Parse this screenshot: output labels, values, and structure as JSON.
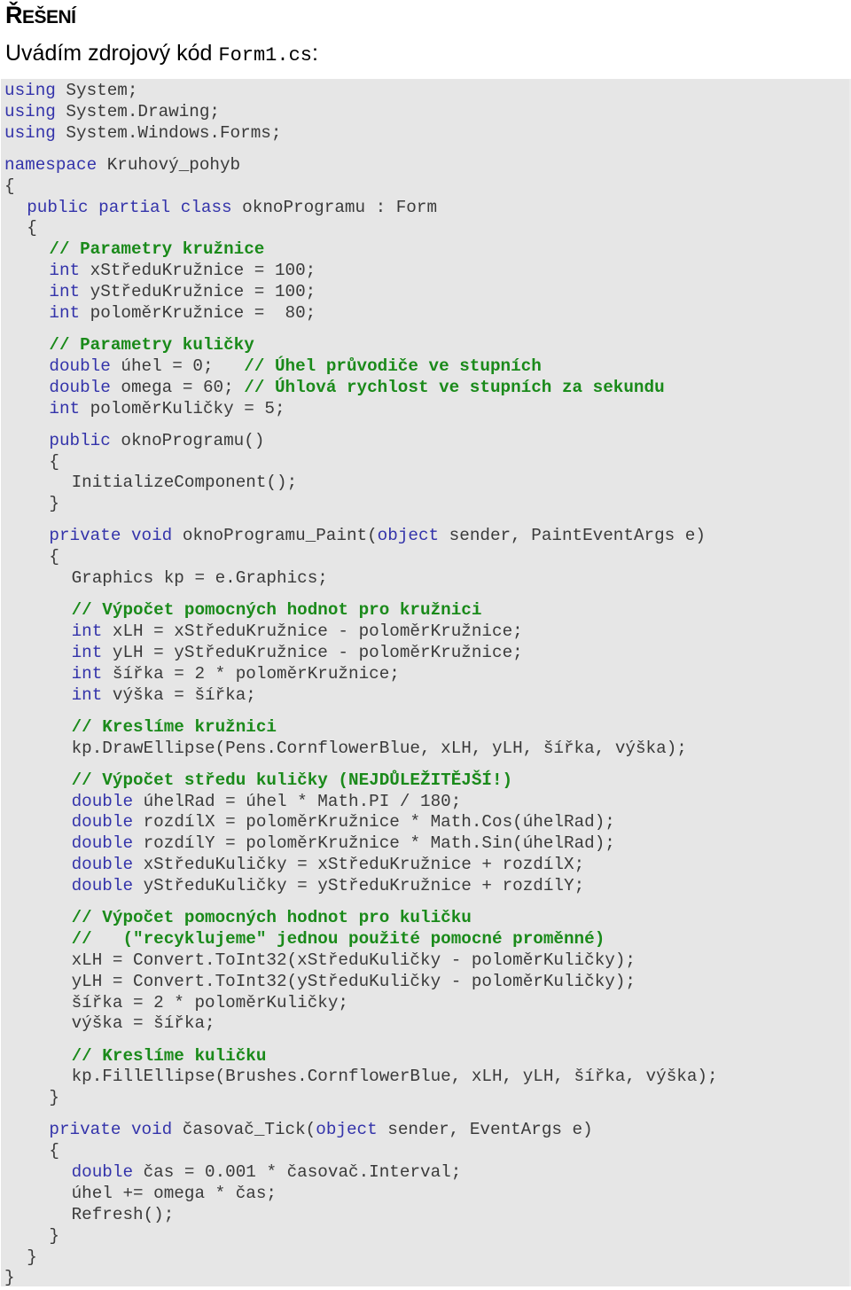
{
  "heading": {
    "first_letter": "Ř",
    "rest": "EŠENÍ"
  },
  "intro": {
    "text": "Uvádím zdrojový kód ",
    "filename": "Form1.cs",
    "suffix": ":"
  },
  "colors": {
    "keyword": "#3333aa",
    "comment": "#1a8a1a",
    "text": "#3a3a3a",
    "code_background": "#e6e6e6"
  },
  "code": {
    "language": "C#",
    "lines": [
      {
        "indent": 0,
        "parts": [
          {
            "t": "kw",
            "s": "using"
          },
          {
            "t": "tx",
            "s": " System;"
          }
        ]
      },
      {
        "indent": 0,
        "parts": [
          {
            "t": "kw",
            "s": "using"
          },
          {
            "t": "tx",
            "s": " System.Drawing;"
          }
        ]
      },
      {
        "indent": 0,
        "parts": [
          {
            "t": "kw",
            "s": "using"
          },
          {
            "t": "tx",
            "s": " System.Windows.Forms;"
          }
        ]
      },
      {
        "indent": 0,
        "gap": true,
        "parts": [
          {
            "t": "kw",
            "s": "namespace"
          },
          {
            "t": "tx",
            "s": " Kruhový_pohyb"
          }
        ]
      },
      {
        "indent": 0,
        "parts": [
          {
            "t": "tx",
            "s": "{"
          }
        ]
      },
      {
        "indent": 1,
        "parts": [
          {
            "t": "kw",
            "s": "public partial class"
          },
          {
            "t": "tx",
            "s": " oknoProgramu : Form"
          }
        ]
      },
      {
        "indent": 1,
        "parts": [
          {
            "t": "tx",
            "s": "{"
          }
        ]
      },
      {
        "indent": 2,
        "parts": [
          {
            "t": "cm",
            "s": "// Parametry kružnice"
          }
        ]
      },
      {
        "indent": 2,
        "parts": [
          {
            "t": "kw",
            "s": "int"
          },
          {
            "t": "tx",
            "s": " xStředuKružnice = 100;"
          }
        ]
      },
      {
        "indent": 2,
        "parts": [
          {
            "t": "kw",
            "s": "int"
          },
          {
            "t": "tx",
            "s": " yStředuKružnice = 100;"
          }
        ]
      },
      {
        "indent": 2,
        "parts": [
          {
            "t": "kw",
            "s": "int"
          },
          {
            "t": "tx",
            "s": " poloměrKružnice =  80;"
          }
        ]
      },
      {
        "indent": 2,
        "gap": true,
        "parts": [
          {
            "t": "cm",
            "s": "// Parametry kuličky"
          }
        ]
      },
      {
        "indent": 2,
        "parts": [
          {
            "t": "kw",
            "s": "double"
          },
          {
            "t": "tx",
            "s": " úhel = 0;   "
          },
          {
            "t": "cm",
            "s": "// Úhel průvodiče ve stupních"
          }
        ]
      },
      {
        "indent": 2,
        "parts": [
          {
            "t": "kw",
            "s": "double"
          },
          {
            "t": "tx",
            "s": " omega = 60; "
          },
          {
            "t": "cm",
            "s": "// Úhlová rychlost ve stupních za sekundu"
          }
        ]
      },
      {
        "indent": 2,
        "parts": [
          {
            "t": "kw",
            "s": "int"
          },
          {
            "t": "tx",
            "s": " poloměrKuličky = 5;"
          }
        ]
      },
      {
        "indent": 2,
        "gap": true,
        "parts": [
          {
            "t": "kw",
            "s": "public"
          },
          {
            "t": "tx",
            "s": " oknoProgramu()"
          }
        ]
      },
      {
        "indent": 2,
        "parts": [
          {
            "t": "tx",
            "s": "{"
          }
        ]
      },
      {
        "indent": 3,
        "parts": [
          {
            "t": "tx",
            "s": "InitializeComponent();"
          }
        ]
      },
      {
        "indent": 2,
        "parts": [
          {
            "t": "tx",
            "s": "}"
          }
        ]
      },
      {
        "indent": 2,
        "gap": true,
        "parts": [
          {
            "t": "kw",
            "s": "private void"
          },
          {
            "t": "tx",
            "s": " oknoProgramu_Paint("
          },
          {
            "t": "kw",
            "s": "object"
          },
          {
            "t": "tx",
            "s": " sender, PaintEventArgs e)"
          }
        ]
      },
      {
        "indent": 2,
        "parts": [
          {
            "t": "tx",
            "s": "{"
          }
        ]
      },
      {
        "indent": 3,
        "parts": [
          {
            "t": "tx",
            "s": "Graphics kp = e.Graphics;"
          }
        ]
      },
      {
        "indent": 3,
        "gap": true,
        "parts": [
          {
            "t": "cm",
            "s": "// Výpočet pomocných hodnot pro kružnici"
          }
        ]
      },
      {
        "indent": 3,
        "parts": [
          {
            "t": "kw",
            "s": "int"
          },
          {
            "t": "tx",
            "s": " xLH = xStředuKružnice - poloměrKružnice;"
          }
        ]
      },
      {
        "indent": 3,
        "parts": [
          {
            "t": "kw",
            "s": "int"
          },
          {
            "t": "tx",
            "s": " yLH = yStředuKružnice - poloměrKružnice;"
          }
        ]
      },
      {
        "indent": 3,
        "parts": [
          {
            "t": "kw",
            "s": "int"
          },
          {
            "t": "tx",
            "s": " šířka = 2 * poloměrKružnice;"
          }
        ]
      },
      {
        "indent": 3,
        "parts": [
          {
            "t": "kw",
            "s": "int"
          },
          {
            "t": "tx",
            "s": " výška = šířka;"
          }
        ]
      },
      {
        "indent": 3,
        "gap": true,
        "parts": [
          {
            "t": "cm",
            "s": "// Kreslíme kružnici"
          }
        ]
      },
      {
        "indent": 3,
        "parts": [
          {
            "t": "tx",
            "s": "kp.DrawEllipse(Pens.CornflowerBlue, xLH, yLH, šířka, výška);"
          }
        ]
      },
      {
        "indent": 3,
        "gap": true,
        "parts": [
          {
            "t": "cm",
            "s": "// Výpočet středu kuličky (NEJDŮLEŽITĚJŠÍ!)"
          }
        ]
      },
      {
        "indent": 3,
        "parts": [
          {
            "t": "kw",
            "s": "double"
          },
          {
            "t": "tx",
            "s": " úhelRad = úhel * Math.PI / 180;"
          }
        ]
      },
      {
        "indent": 3,
        "parts": [
          {
            "t": "kw",
            "s": "double"
          },
          {
            "t": "tx",
            "s": " rozdílX = poloměrKružnice * Math.Cos(úhelRad);"
          }
        ]
      },
      {
        "indent": 3,
        "parts": [
          {
            "t": "kw",
            "s": "double"
          },
          {
            "t": "tx",
            "s": " rozdílY = poloměrKružnice * Math.Sin(úhelRad);"
          }
        ]
      },
      {
        "indent": 3,
        "parts": [
          {
            "t": "kw",
            "s": "double"
          },
          {
            "t": "tx",
            "s": " xStředuKuličky = xStředuKružnice + rozdílX;"
          }
        ]
      },
      {
        "indent": 3,
        "parts": [
          {
            "t": "kw",
            "s": "double"
          },
          {
            "t": "tx",
            "s": " yStředuKuličky = yStředuKružnice + rozdílY;"
          }
        ]
      },
      {
        "indent": 3,
        "gap": true,
        "parts": [
          {
            "t": "cm",
            "s": "// Výpočet pomocných hodnot pro kuličku"
          }
        ]
      },
      {
        "indent": 3,
        "parts": [
          {
            "t": "cm",
            "s": "//   (\"recyklujeme\" jednou použité pomocné proměnné)"
          }
        ]
      },
      {
        "indent": 3,
        "parts": [
          {
            "t": "tx",
            "s": "xLH = Convert.ToInt32(xStředuKuličky - poloměrKuličky);"
          }
        ]
      },
      {
        "indent": 3,
        "parts": [
          {
            "t": "tx",
            "s": "yLH = Convert.ToInt32(yStředuKuličky - poloměrKuličky);"
          }
        ]
      },
      {
        "indent": 3,
        "parts": [
          {
            "t": "tx",
            "s": "šířka = 2 * poloměrKuličky;"
          }
        ]
      },
      {
        "indent": 3,
        "parts": [
          {
            "t": "tx",
            "s": "výška = šířka;"
          }
        ]
      },
      {
        "indent": 3,
        "gap": true,
        "parts": [
          {
            "t": "cm",
            "s": "// Kreslíme kuličku"
          }
        ]
      },
      {
        "indent": 3,
        "parts": [
          {
            "t": "tx",
            "s": "kp.FillEllipse(Brushes.CornflowerBlue, xLH, yLH, šířka, výška);"
          }
        ]
      },
      {
        "indent": 2,
        "parts": [
          {
            "t": "tx",
            "s": "}"
          }
        ]
      },
      {
        "indent": 2,
        "gap": true,
        "parts": [
          {
            "t": "kw",
            "s": "private void"
          },
          {
            "t": "tx",
            "s": " časovač_Tick("
          },
          {
            "t": "kw",
            "s": "object"
          },
          {
            "t": "tx",
            "s": " sender, EventArgs e)"
          }
        ]
      },
      {
        "indent": 2,
        "parts": [
          {
            "t": "tx",
            "s": "{"
          }
        ]
      },
      {
        "indent": 3,
        "parts": [
          {
            "t": "kw",
            "s": "double"
          },
          {
            "t": "tx",
            "s": " čas = 0.001 * časovač.Interval;"
          }
        ]
      },
      {
        "indent": 3,
        "parts": [
          {
            "t": "tx",
            "s": "úhel += omega * čas;"
          }
        ]
      },
      {
        "indent": 3,
        "parts": [
          {
            "t": "tx",
            "s": "Refresh();"
          }
        ]
      },
      {
        "indent": 2,
        "parts": [
          {
            "t": "tx",
            "s": "}"
          }
        ]
      },
      {
        "indent": 1,
        "parts": [
          {
            "t": "tx",
            "s": "}"
          }
        ]
      },
      {
        "indent": 0,
        "parts": [
          {
            "t": "tx",
            "s": "}"
          }
        ]
      }
    ]
  }
}
